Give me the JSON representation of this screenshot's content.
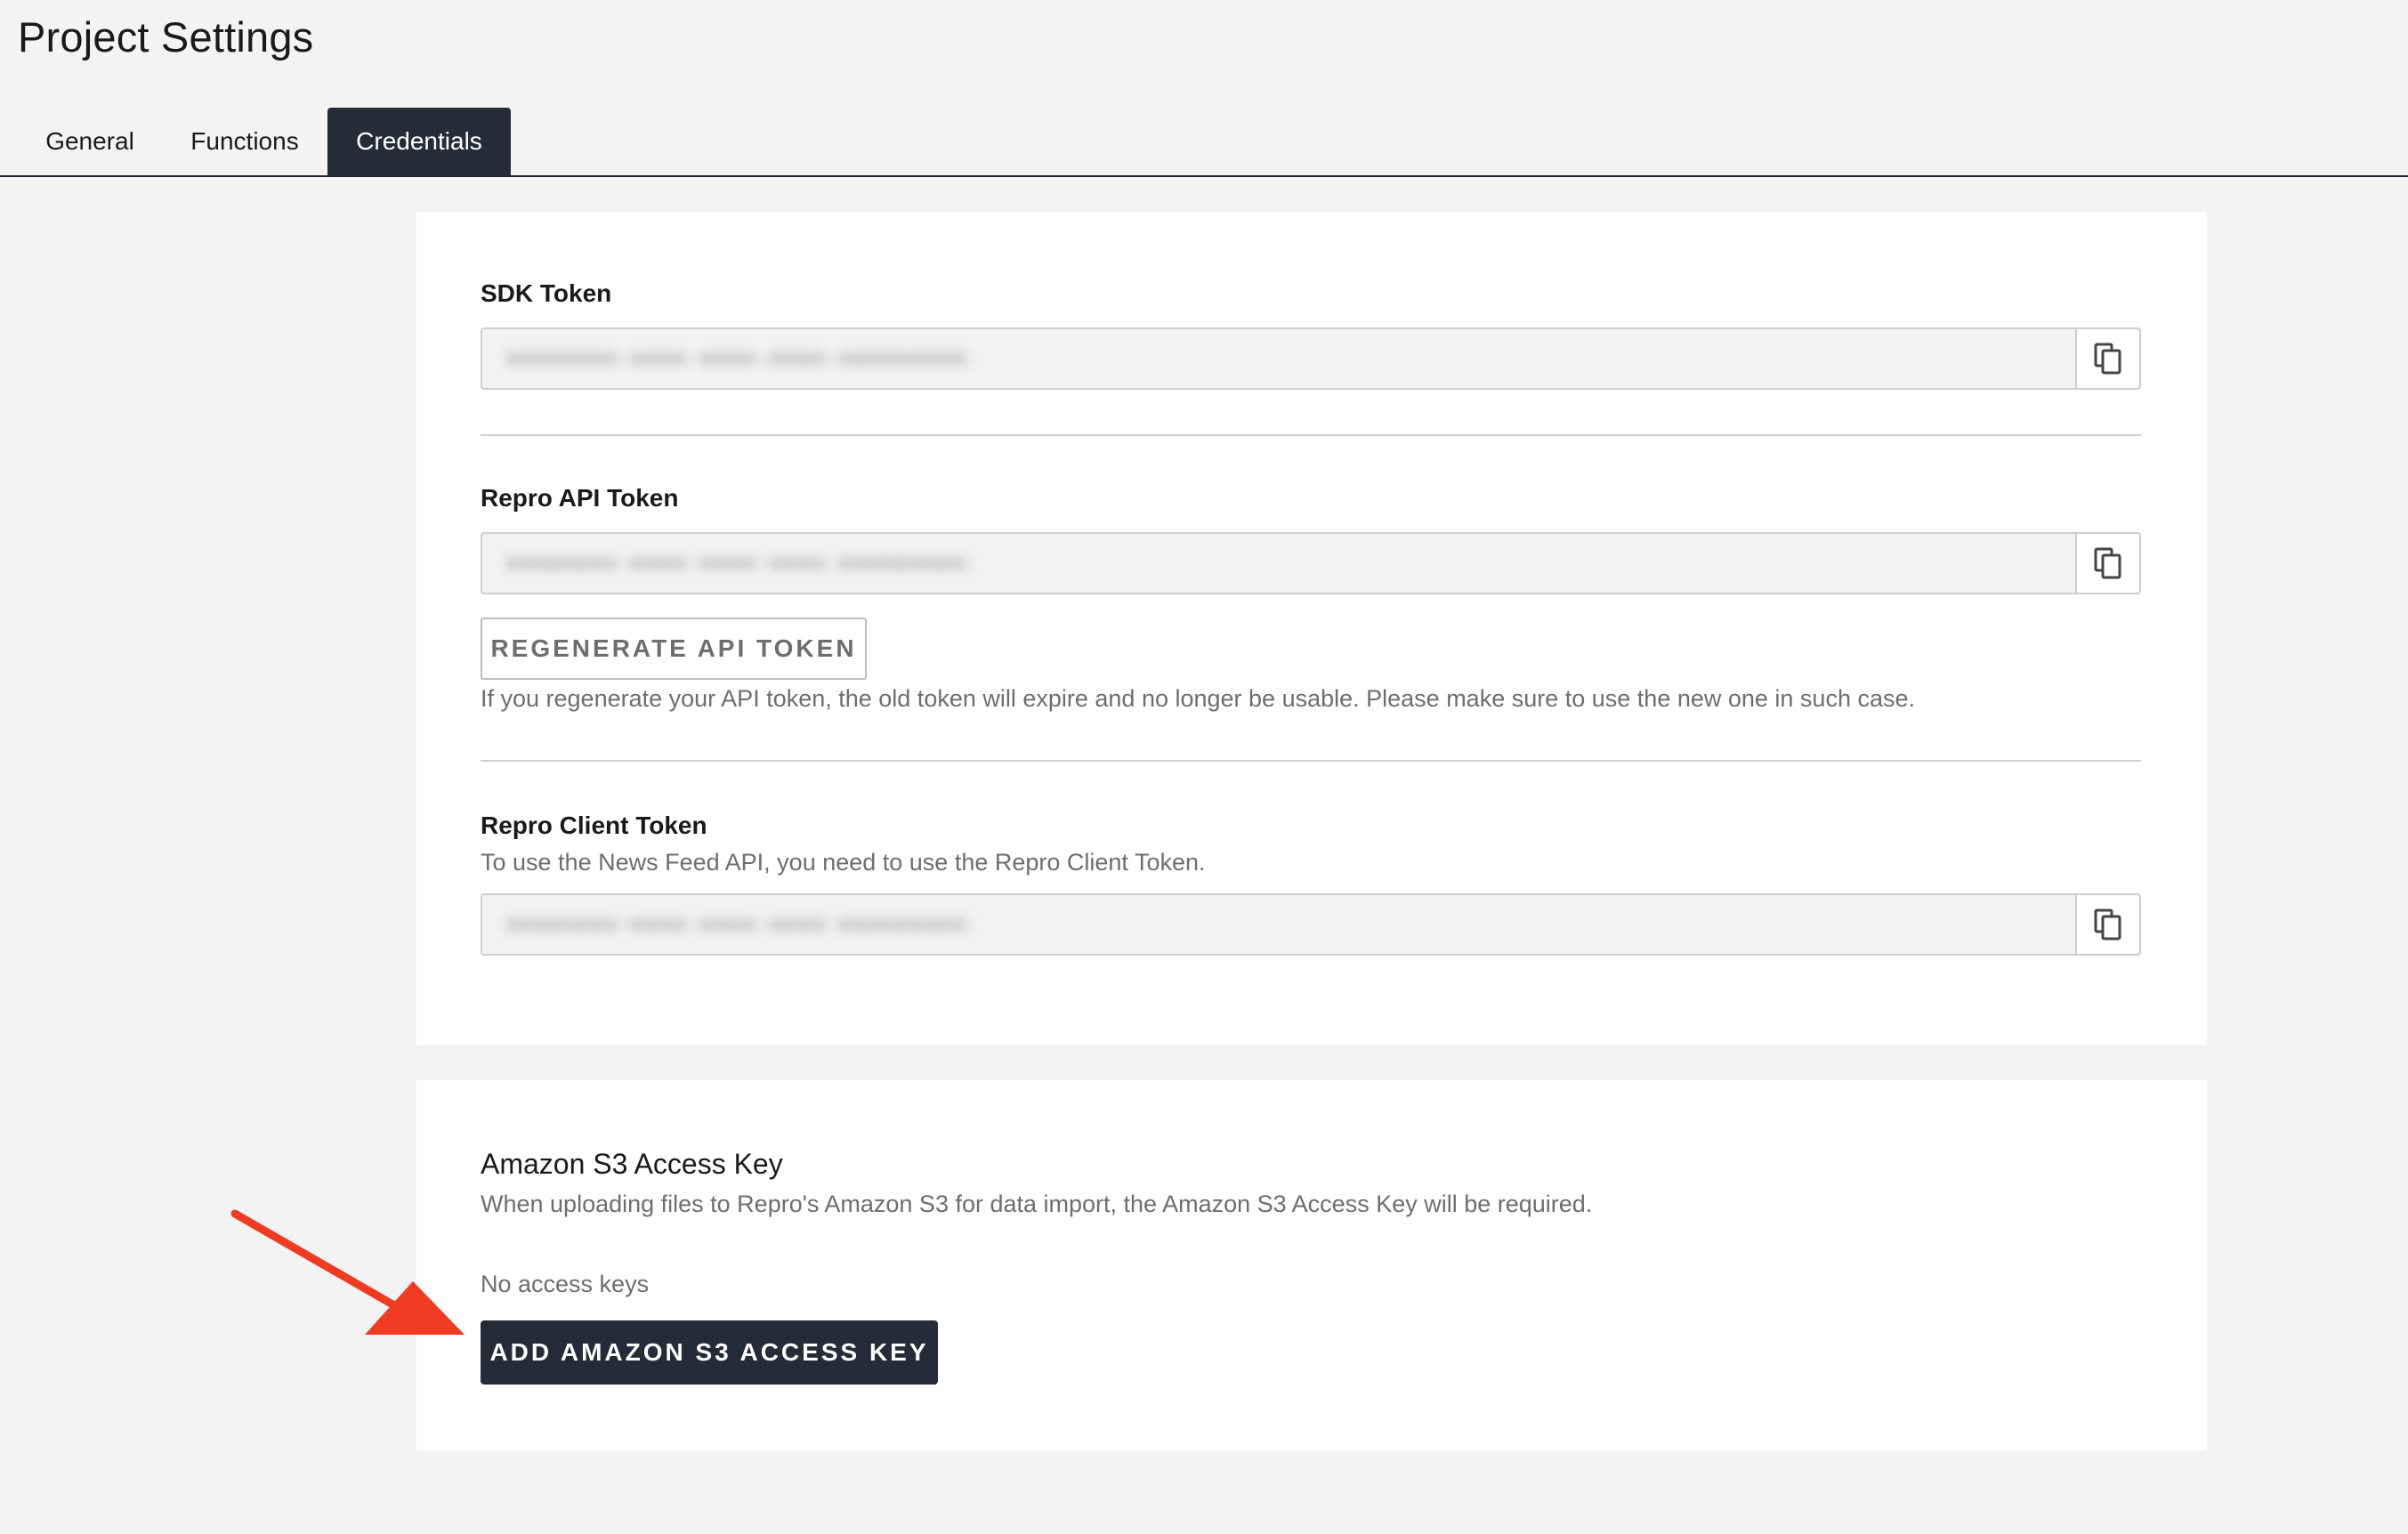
{
  "header": {
    "title": "Project Settings"
  },
  "tabs": [
    {
      "label": "General",
      "active": false
    },
    {
      "label": "Functions",
      "active": false
    },
    {
      "label": "Credentials",
      "active": true
    }
  ],
  "credentials": {
    "sdk_token": {
      "label": "SDK Token",
      "value": "xxxxxxxx-xxxx-xxxx-xxxx-xxxxxxxxxxxx",
      "copy_icon": "copy-icon"
    },
    "api_token": {
      "label": "Repro API Token",
      "value": "xxxxxxxx-xxxx-xxxx-xxxx-xxxxxxxxxxxx",
      "copy_icon": "copy-icon",
      "regenerate_label": "REGENERATE API TOKEN",
      "regenerate_help": "If you regenerate your API token, the old token will expire and no longer be usable. Please make sure to use the new one in such case."
    },
    "client_token": {
      "label": "Repro Client Token",
      "description": "To use the News Feed API, you need to use the Repro Client Token.",
      "value": "xxxxxxxx-xxxx-xxxx-xxxx-xxxxxxxxxxxx",
      "copy_icon": "copy-icon"
    }
  },
  "s3": {
    "title": "Amazon S3 Access Key",
    "description": "When uploading files to Repro's Amazon S3 for data import, the Amazon S3 Access Key will be required.",
    "empty_state": "No access keys",
    "add_label": "ADD AMAZON S3 ACCESS KEY"
  },
  "colors": {
    "page_bg": "#f3f3f3",
    "card_bg": "#ffffff",
    "primary": "#262b38",
    "annotation_arrow": "#f03a22",
    "muted_text": "#6e6e6e"
  }
}
